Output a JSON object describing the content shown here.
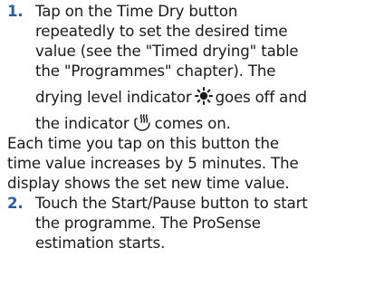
{
  "steps": [
    {
      "number": "1.",
      "lines": [
        "Tap on the Time Dry button",
        "repeatedly to set the desired time",
        "value (see the \"Timed drying\" table",
        "the \"Programmes\" chapter). The",
        "drying level indicator",
        "goes off and",
        "the indicator",
        "comes on."
      ],
      "icons": [
        "drying-level-sun-icon",
        "time-dry-hanging-icon"
      ]
    },
    {
      "number": "2.",
      "lines": [
        "Touch the Start/Pause button to start",
        "the programme. The ProSense",
        "estimation starts."
      ]
    }
  ],
  "paragraph": {
    "lines": [
      "Each time you tap on this button the",
      "time value increases by 5 minutes. The",
      "display shows the set new time value."
    ]
  },
  "colors": {
    "step_number": "#1f5fae",
    "text": "#1a1a1a"
  }
}
